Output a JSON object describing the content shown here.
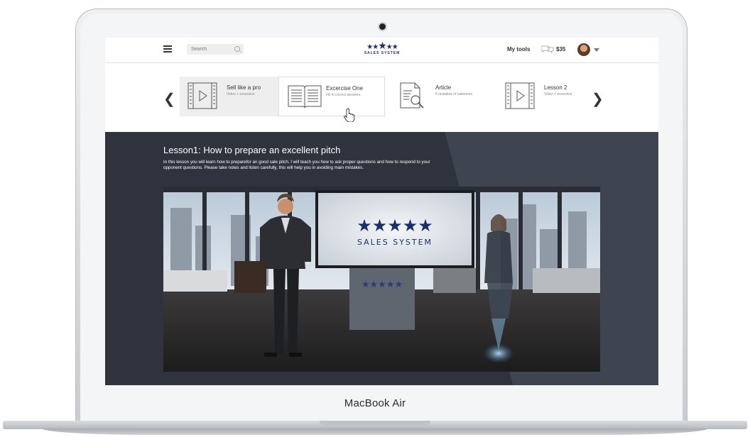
{
  "device": {
    "brand": "MacBook Air"
  },
  "topbar": {
    "search_placeholder": "Search",
    "logo_word": "SALES SYSTEM",
    "my_tools_label": "My tools",
    "credits": "$35"
  },
  "carousel": {
    "items": [
      {
        "title": "Sell like a pro",
        "subtitle": "Video + excersice",
        "icon": "video-icon"
      },
      {
        "title": "Excercise One",
        "subtitle": "Fill in correct answers",
        "icon": "book-icon"
      },
      {
        "title": "Article",
        "subtitle": "5 mistakes of salesmen",
        "icon": "article-search-icon"
      },
      {
        "title": "Lesson 2",
        "subtitle": "Video + excersice",
        "icon": "video-icon"
      }
    ]
  },
  "lesson": {
    "title": "Lesson1: How to prepare an excellent pitch",
    "description": "In this lesson you will learn how to preparefor an good sale pitch. I will teach you how to ask proper questions and how to respond to your opponent questions. Please take notes and listen carefully, this will help you in avoiding main mistakes."
  },
  "video": {
    "screen_logo_word": "SALES SYSTEM"
  },
  "colors": {
    "brand_navy": "#1d2f6b",
    "lesson_bg": "#2e333d"
  }
}
